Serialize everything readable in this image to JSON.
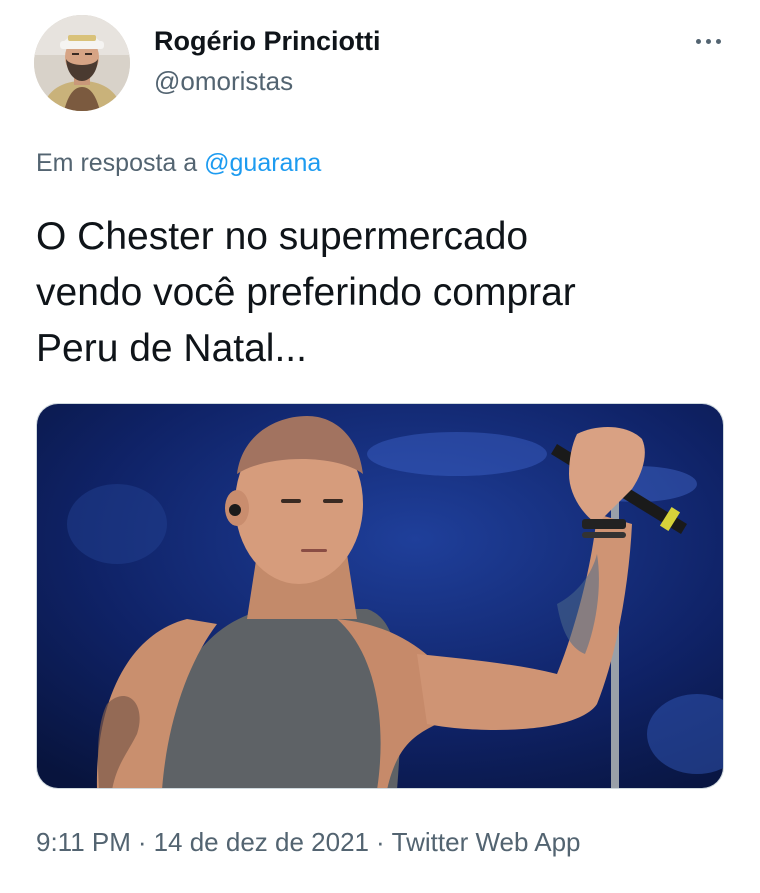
{
  "tweet": {
    "author": {
      "display_name": "Rogério Princiotti",
      "handle": "@omoristas"
    },
    "reply_context": {
      "prefix": "Em resposta a",
      "mention": "@guarana"
    },
    "text_lines": [
      "O Chester no supermercado",
      "vendo você preferindo comprar",
      "Peru de Natal..."
    ],
    "meta": {
      "time": "9:11 PM",
      "separator": "·",
      "date": "14 de dez de 2021",
      "source": "Twitter Web App"
    },
    "icons": {
      "more": "more-horizontal-icon"
    },
    "colors": {
      "primary_text": "#0f1419",
      "secondary_text": "#536471",
      "link": "#1d9bf0",
      "border": "#cfd9de"
    }
  }
}
